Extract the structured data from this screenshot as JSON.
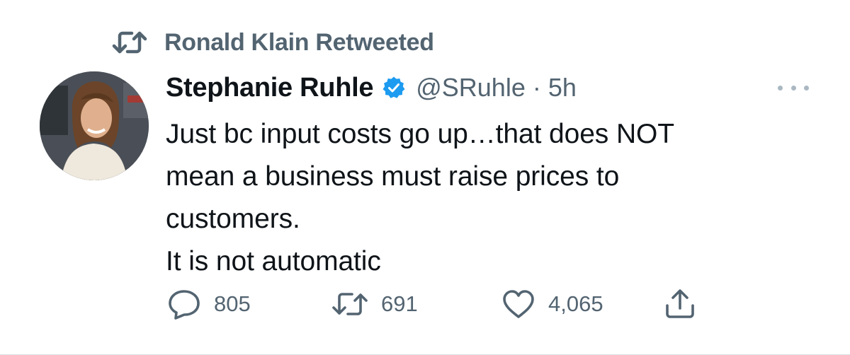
{
  "social_context": {
    "icon": "retweet-icon",
    "text": "Ronald Klain Retweeted"
  },
  "author": {
    "display_name": "Stephanie Ruhle",
    "verified": true,
    "handle": "@SRuhle",
    "separator": "·",
    "time": "5h",
    "avatar_icon": "avatar"
  },
  "tweet": {
    "lines": [
      "Just bc input costs go up…that does NOT",
      "mean a business must raise prices to",
      "customers.",
      "It is not automatic"
    ]
  },
  "actions": {
    "reply": {
      "icon": "reply-icon",
      "count": "805"
    },
    "retweet": {
      "icon": "retweet-icon",
      "count": "691"
    },
    "like": {
      "icon": "heart-icon",
      "count": "4,065"
    },
    "share": {
      "icon": "share-icon"
    }
  },
  "colors": {
    "text_primary": "#0f1419",
    "text_secondary": "#536471",
    "verified_blue": "#1d9bf0",
    "more_dots": "#aab8c2"
  }
}
